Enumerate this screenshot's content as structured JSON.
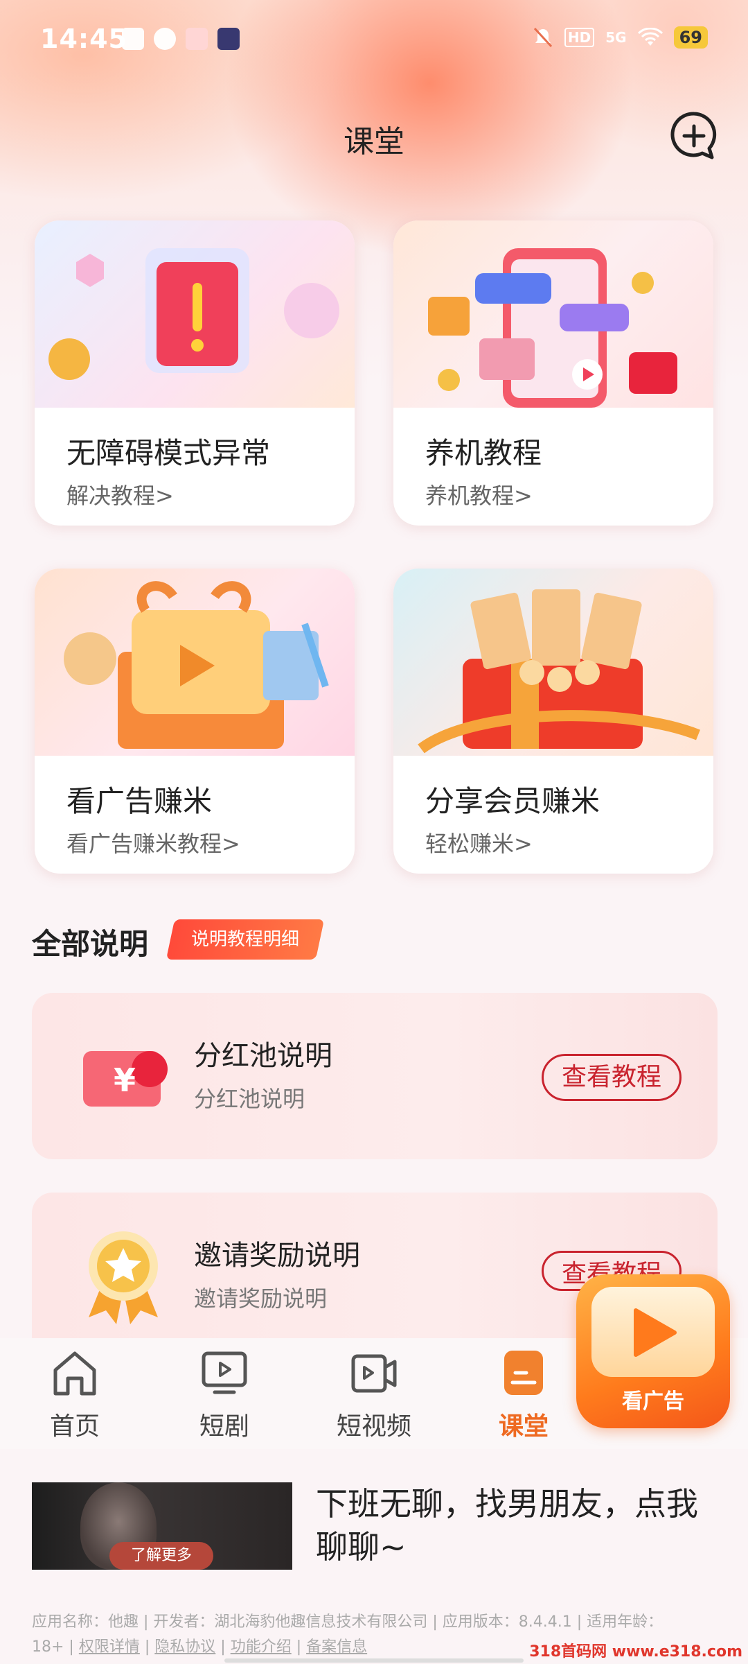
{
  "status_bar": {
    "time": "14:45",
    "network": "5G",
    "hd": "HD",
    "battery": "69"
  },
  "header": {
    "title": "课堂"
  },
  "cards": [
    {
      "title": "无障碍模式异常",
      "subtitle": "解决教程>"
    },
    {
      "title": "养机教程",
      "subtitle": "养机教程>"
    },
    {
      "title": "看广告赚米",
      "subtitle": "看广告赚米教程>"
    },
    {
      "title": "分享会员赚米",
      "subtitle": "轻松赚米>"
    }
  ],
  "section": {
    "title": "全部说明",
    "tag": "说明教程明细"
  },
  "info_rows": [
    {
      "title": "分红池说明",
      "subtitle": "分红池说明",
      "button": "查看教程"
    },
    {
      "title": "邀请奖励说明",
      "subtitle": "邀请奖励说明",
      "button": "查看教程"
    }
  ],
  "nav": {
    "items": [
      {
        "label": "首页"
      },
      {
        "label": "短剧"
      },
      {
        "label": "短视频"
      },
      {
        "label": "课堂"
      }
    ],
    "active_index": 3
  },
  "float_ad": {
    "label": "看广告"
  },
  "banner_ad": {
    "button": "了解更多",
    "text": "下班无聊，找男朋友，点我聊聊~"
  },
  "footer": {
    "line1": "应用名称：他趣 | 开发者：湖北海豹他趣信息技术有限公司 | 应用版本：8.4.4.1 | 适用年龄：",
    "age": "18+",
    "links": [
      "权限详情",
      "隐私协议",
      "功能介绍",
      "备案信息"
    ]
  },
  "watermark": "318首码网 www.e318.com",
  "colors": {
    "accent": "#ee6a22",
    "button_red": "#c9232e",
    "tag_red": "#ff4a3a"
  }
}
